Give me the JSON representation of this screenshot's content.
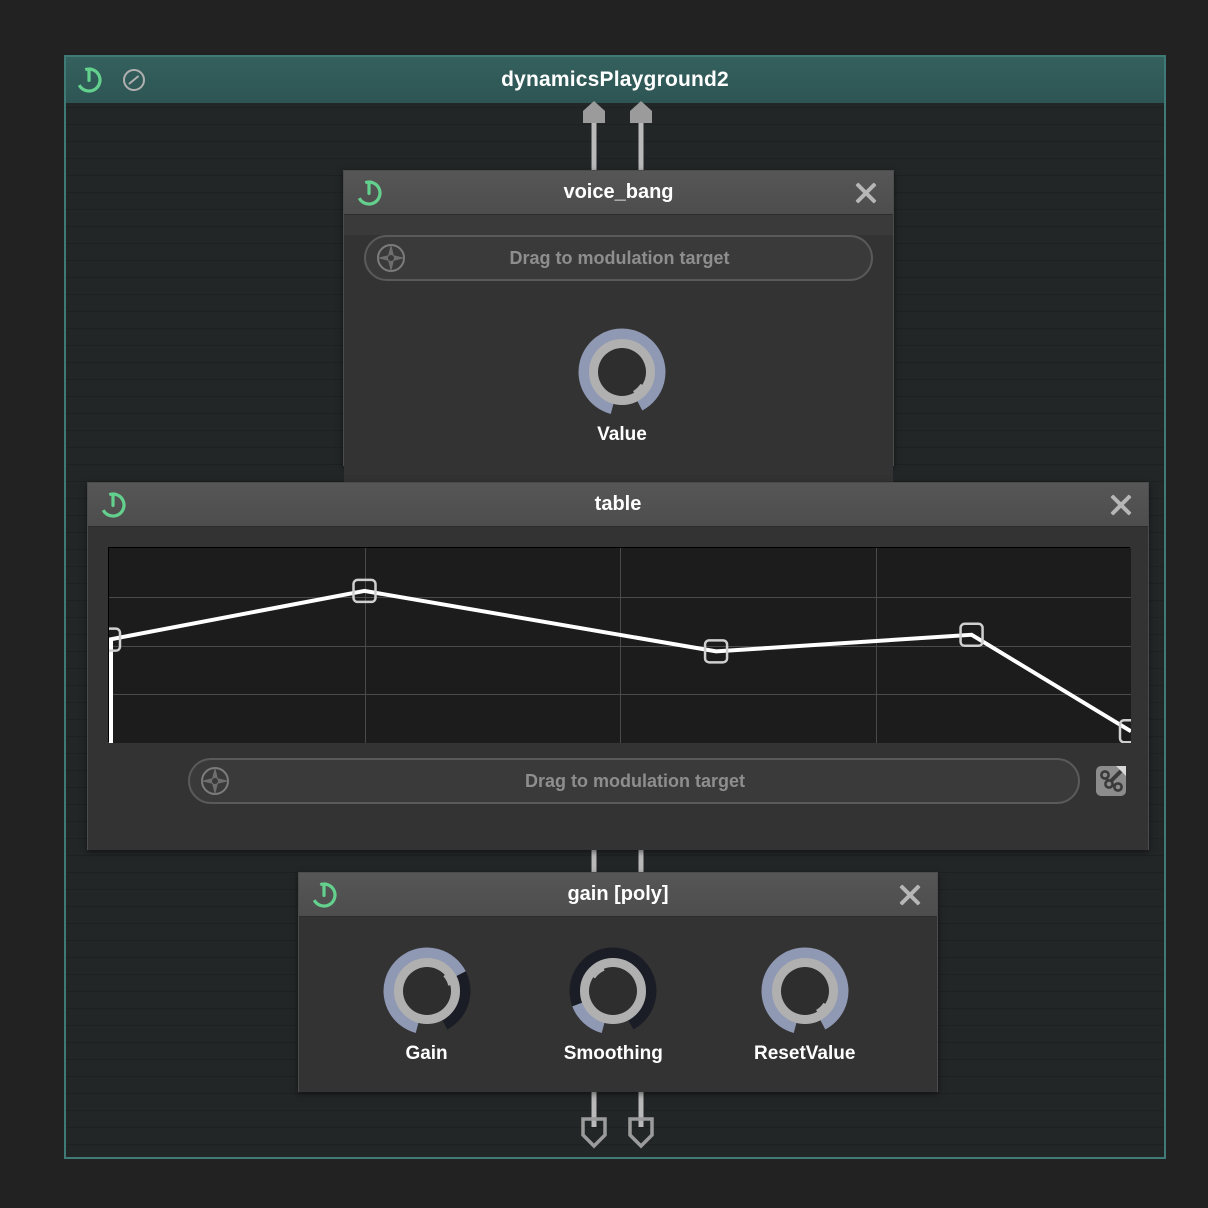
{
  "patch": {
    "title": "dynamicsPlayground2",
    "power_icon": "power-icon",
    "meter_icon": "meter-icon",
    "accent_color": "#3f7a77",
    "titlebar_color": "#34605e"
  },
  "modules": [
    {
      "id": "voice_bang",
      "title": "voice_bang",
      "power_icon": "power-icon",
      "close_icon": "close-icon",
      "modulation": {
        "label": "Drag to modulation target",
        "icon": "modulation-target-icon"
      },
      "knobs": [
        {
          "label": "Value",
          "value_pct": 100,
          "style": "full"
        }
      ]
    },
    {
      "id": "table",
      "title": "table",
      "power_icon": "power-icon",
      "close_icon": "close-icon",
      "modulation": {
        "label": "Drag to modulation target",
        "icon": "modulation-target-icon"
      },
      "expand_icon": "expand-editor-icon"
    },
    {
      "id": "gain",
      "title": "gain [poly]",
      "power_icon": "power-icon",
      "close_icon": "close-icon",
      "knobs": [
        {
          "label": "Gain",
          "value_pct": 72,
          "style": "partial"
        },
        {
          "label": "Smoothing",
          "value_pct": 12,
          "style": "partial"
        },
        {
          "label": "ResetValue",
          "value_pct": 100,
          "style": "full"
        }
      ]
    }
  ],
  "chart_data": {
    "type": "line",
    "title": "table",
    "xlabel": "",
    "ylabel": "",
    "xlim": [
      0,
      1
    ],
    "ylim": [
      0,
      1
    ],
    "grid": true,
    "grid_columns": 4,
    "grid_rows": 4,
    "legend": "none",
    "breakpoints": [
      {
        "x": 0.0,
        "y": 0.53
      },
      {
        "x": 0.25,
        "y": 0.78
      },
      {
        "x": 0.594,
        "y": 0.47
      },
      {
        "x": 0.844,
        "y": 0.555
      },
      {
        "x": 1.0,
        "y": 0.06
      }
    ],
    "handle_shape": "square",
    "line_color": "#ffffff",
    "background_color": "#1c1c1c"
  },
  "ports": {
    "top": [
      {
        "name": "patch-inlet-1",
        "direction": "in"
      },
      {
        "name": "patch-inlet-2",
        "direction": "in"
      }
    ],
    "bottom": [
      {
        "name": "patch-outlet-1",
        "direction": "out"
      },
      {
        "name": "patch-outlet-2",
        "direction": "out"
      }
    ]
  }
}
